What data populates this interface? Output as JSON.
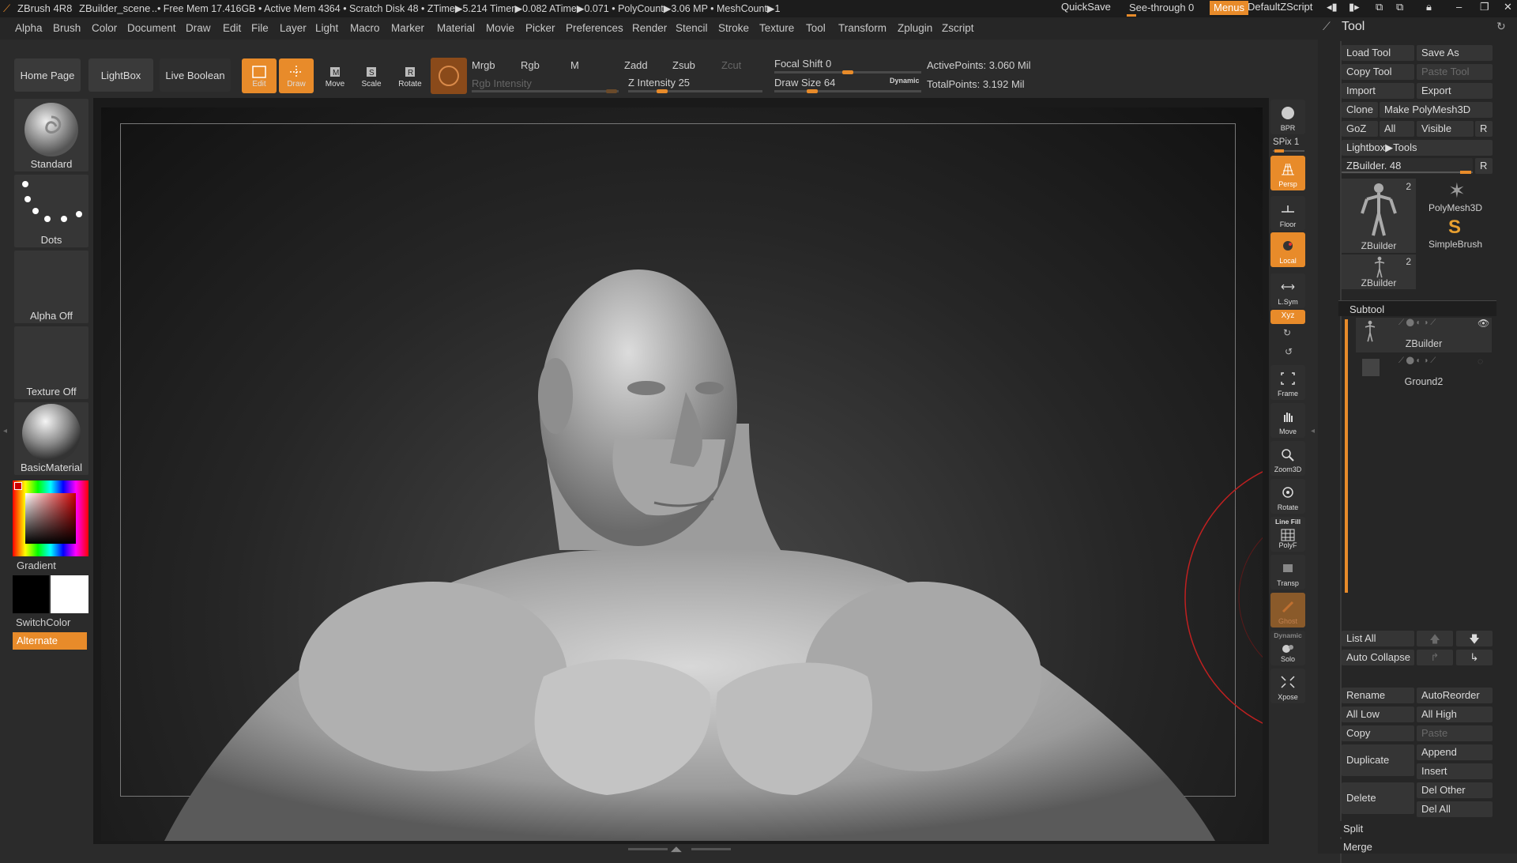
{
  "titlebar": {
    "app": "ZBrush 4R8",
    "scene": "ZBuilder_scene",
    "stats": "..• Free Mem 17.416GB • Active Mem 4364 • Scratch Disk 48 • ZTime▶5.214 Timer▶0.082 ATime▶0.071 • PolyCount▶3.06 MP • MeshCount▶1",
    "quicksave": "QuickSave",
    "seethrough_label": "See-through",
    "seethrough_value": "0",
    "menus": "Menus",
    "script": "DefaultZScript"
  },
  "menubar": {
    "items": [
      "Alpha",
      "Brush",
      "Color",
      "Document",
      "Draw",
      "Edit",
      "File",
      "Layer",
      "Light",
      "Macro",
      "Marker",
      "Material",
      "Movie",
      "Picker",
      "Preferences",
      "Render",
      "Stencil",
      "Stroke",
      "Texture",
      "Tool",
      "Transform",
      "Zplugin",
      "Zscript"
    ]
  },
  "toolbar": {
    "home": "Home Page",
    "lightbox": "LightBox",
    "liveboolean": "Live Boolean",
    "edit": "Edit",
    "draw": "Draw",
    "move": "Move",
    "scale": "Scale",
    "rotate": "Rotate",
    "mrgb": "Mrgb",
    "rgb": "Rgb",
    "m": "M",
    "rgb_intensity": "Rgb Intensity",
    "zadd": "Zadd",
    "zsub": "Zsub",
    "zcut": "Zcut",
    "z_intensity": "Z Intensity 25",
    "focal_shift": "Focal Shift 0",
    "draw_size": "Draw Size 64",
    "dynamic": "Dynamic",
    "active_points": "ActivePoints: 3.060 Mil",
    "total_points": "TotalPoints: 3.192 Mil",
    "z_intensity_level": 25,
    "focal_shift_level": 0,
    "draw_size_level": 64
  },
  "leftshelf": {
    "brush": "Standard",
    "stroke": "Dots",
    "alpha": "Alpha Off",
    "texture": "Texture Off",
    "material": "BasicMaterial",
    "gradient": "Gradient",
    "switchcolor": "SwitchColor",
    "alternate": "Alternate"
  },
  "rightshelf": {
    "bpr": "BPR",
    "spix": "SPix 1",
    "persp": "Persp",
    "floor": "Floor",
    "local": "Local",
    "lsym": "L.Sym",
    "xyz": "Xyz",
    "frame": "Frame",
    "move": "Move",
    "zoom3d": "Zoom3D",
    "rotate": "Rotate",
    "linefill": "Line Fill",
    "polyf": "PolyF",
    "transp": "Transp",
    "ghost": "Ghost",
    "dynamic": "Dynamic",
    "solo": "Solo",
    "xpose": "Xpose"
  },
  "toolpanel": {
    "title": "Tool",
    "load": "Load Tool",
    "saveas": "Save As",
    "copy": "Copy Tool",
    "paste": "Paste Tool",
    "import": "Import",
    "export": "Export",
    "clone": "Clone",
    "makepoly": "Make PolyMesh3D",
    "goz": "GoZ",
    "all": "All",
    "visible": "Visible",
    "r": "R",
    "lightbox_tools": "Lightbox▶Tools",
    "zbuilder_slider": "ZBuilder. 48",
    "thumb1": "ZBuilder",
    "thumb1_count": "2",
    "polymesh": "PolyMesh3D",
    "simplebrush": "SimpleBrush",
    "thumb2": "ZBuilder",
    "thumb2_count": "2",
    "subtool": "Subtool",
    "sub1": "ZBuilder",
    "sub2": "Ground2",
    "listall": "List All",
    "autocollapse": "Auto Collapse",
    "rename": "Rename",
    "autoreorder": "AutoReorder",
    "alllow": "All Low",
    "allhigh": "All High",
    "copy2": "Copy",
    "paste2": "Paste",
    "duplicate": "Duplicate",
    "append": "Append",
    "insert": "Insert",
    "delete": "Delete",
    "delother": "Del Other",
    "delall": "Del All",
    "split": "Split",
    "merge": "Merge"
  },
  "colors": {
    "accent": "#e88b2a",
    "panel": "#262626",
    "button": "#353535",
    "viewport_bg": "#1a1a1a"
  }
}
